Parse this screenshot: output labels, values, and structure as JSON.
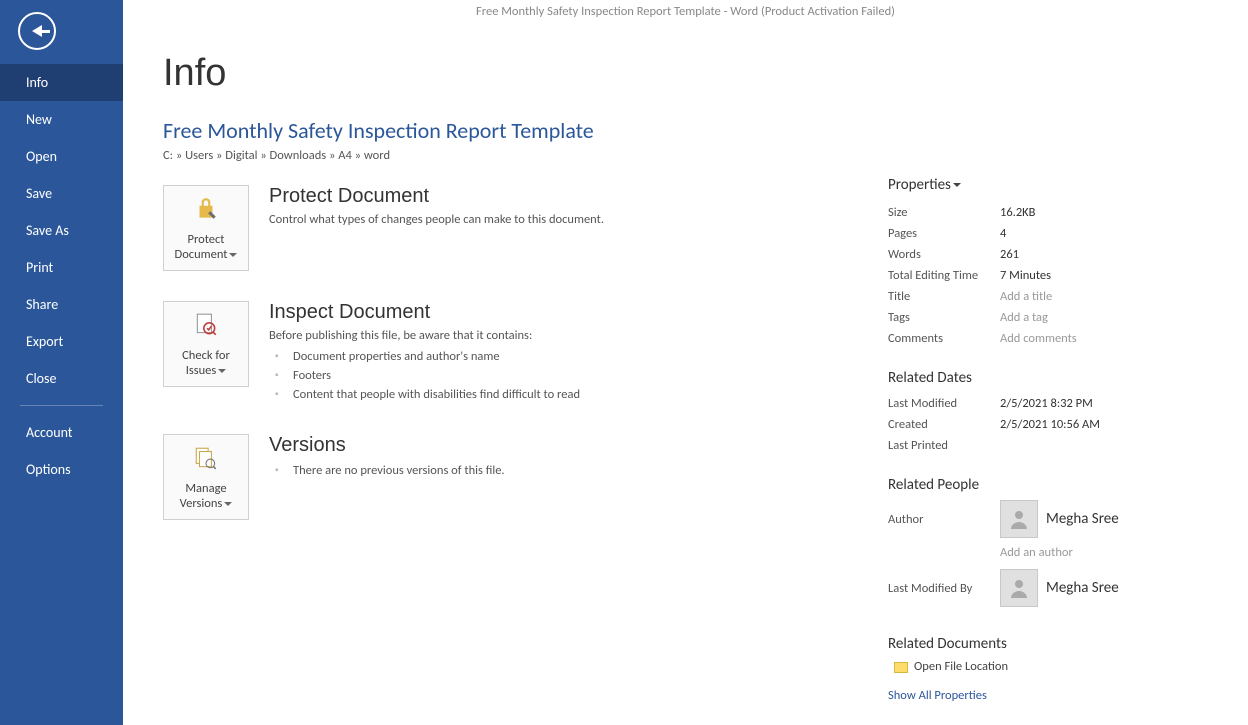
{
  "window_title": "Free Monthly Safety Inspection Report Template - Word (Product Activation Failed)",
  "nav": {
    "items": [
      {
        "label": "Info",
        "active": true
      },
      {
        "label": "New"
      },
      {
        "label": "Open"
      },
      {
        "label": "Save"
      },
      {
        "label": "Save As"
      },
      {
        "label": "Print"
      },
      {
        "label": "Share"
      },
      {
        "label": "Export"
      },
      {
        "label": "Close"
      }
    ],
    "bottom": [
      {
        "label": "Account"
      },
      {
        "label": "Options"
      }
    ]
  },
  "page_title": "Info",
  "doc_title": "Free Monthly Safety Inspection Report Template",
  "breadcrumb": "C: » Users » Digital » Downloads » A4 » word",
  "sections": {
    "protect": {
      "btn_label_1": "Protect",
      "btn_label_2": "Document",
      "heading": "Protect Document",
      "text": "Control what types of changes people can make to this document."
    },
    "inspect": {
      "btn_label_1": "Check for",
      "btn_label_2": "Issues",
      "heading": "Inspect Document",
      "text": "Before publishing this file, be aware that it contains:",
      "items": [
        "Document properties and author's name",
        "Footers",
        "Content that people with disabilities find difficult to read"
      ]
    },
    "versions": {
      "btn_label_1": "Manage",
      "btn_label_2": "Versions",
      "heading": "Versions",
      "text": "There are no previous versions of this file."
    }
  },
  "props": {
    "heading": "Properties",
    "rows": [
      {
        "label": "Size",
        "value": "16.2KB"
      },
      {
        "label": "Pages",
        "value": "4"
      },
      {
        "label": "Words",
        "value": "261"
      },
      {
        "label": "Total Editing Time",
        "value": "7 Minutes"
      },
      {
        "label": "Title",
        "value": "",
        "placeholder": "Add a title"
      },
      {
        "label": "Tags",
        "value": "",
        "placeholder": "Add a tag"
      },
      {
        "label": "Comments",
        "value": "",
        "placeholder": "Add comments"
      }
    ]
  },
  "dates": {
    "heading": "Related Dates",
    "rows": [
      {
        "label": "Last Modified",
        "value": "2/5/2021 8:32 PM"
      },
      {
        "label": "Created",
        "value": "2/5/2021 10:56 AM"
      },
      {
        "label": "Last Printed",
        "value": ""
      }
    ]
  },
  "people": {
    "heading": "Related People",
    "author_label": "Author",
    "author_name": "Megha Sree",
    "add_author": "Add an author",
    "modified_by_label": "Last Modified By",
    "modified_by_name": "Megha Sree"
  },
  "docs": {
    "heading": "Related Documents",
    "open_location": "Open File Location",
    "show_all": "Show All Properties"
  }
}
